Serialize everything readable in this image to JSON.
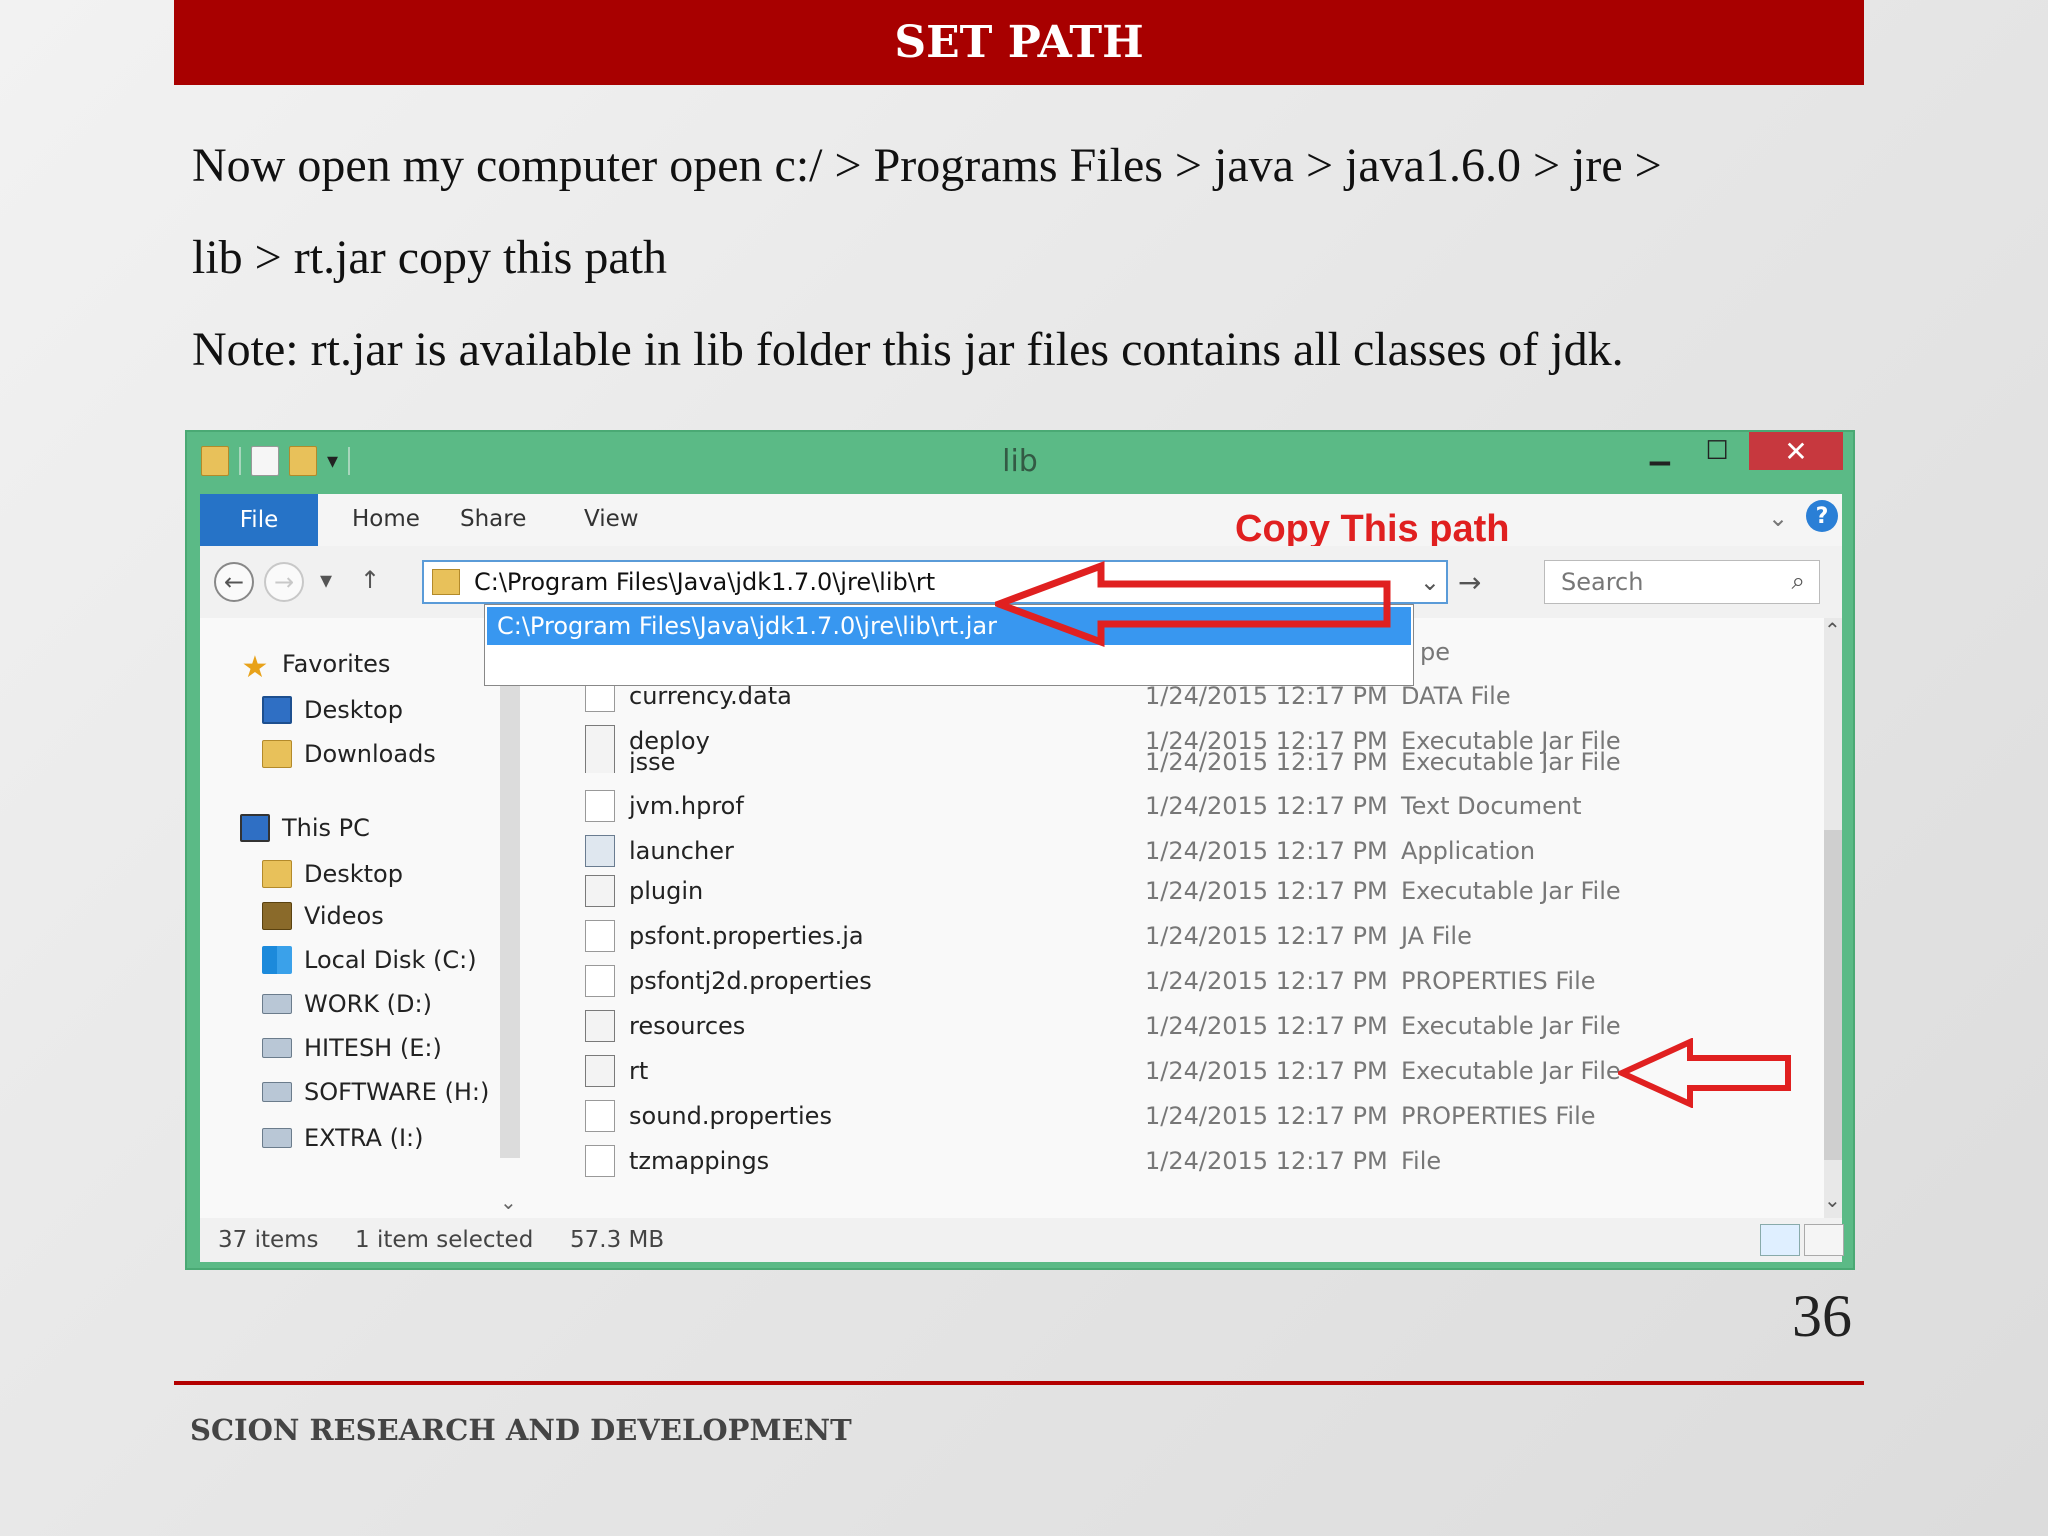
{
  "slide": {
    "title": "SET PATH",
    "line1": "Now open my computer open c:/ > Programs Files > java > java1.6.0 > jre >",
    "line2": "lib > rt.jar copy this path",
    "note": "Note: rt.jar is available in lib folder this jar files contains all classes of jdk.",
    "page_number": "36",
    "footer": "SCION RESEARCH AND DEVELOPMENT"
  },
  "window": {
    "title": "lib",
    "ribbon_tabs": [
      "File",
      "Home",
      "Share",
      "View"
    ],
    "annotation": "Copy This path",
    "address": "C:\\Program Files\\Java\\jdk1.7.0\\jre\\lib\\rt",
    "autocomplete": "C:\\Program Files\\Java\\jdk1.7.0\\jre\\lib\\rt.jar",
    "search_placeholder": "Search",
    "type_header": "pe",
    "close_glyph": "✕",
    "min_glyph": "▁",
    "max_glyph": "☐"
  },
  "nav_pane": {
    "favorites": "Favorites",
    "fav_items": [
      "Desktop",
      "Downloads"
    ],
    "this_pc": "This PC",
    "pc_items": [
      "Desktop",
      "Videos",
      "Local Disk (C:)",
      "WORK (D:)",
      "HITESH (E:)",
      "SOFTWARE (H:)",
      "EXTRA (I:)"
    ]
  },
  "files": [
    {
      "name": "currency.data",
      "date": "1/24/2015 12:17 PM",
      "type": "DATA File",
      "icon": "file"
    },
    {
      "name": "deploy",
      "date": "1/24/2015 12:17 PM",
      "type": "Executable Jar File",
      "icon": "jar"
    },
    {
      "name": "jsse",
      "date": "1/24/2015 12:17 PM",
      "type": "Executable Jar File",
      "icon": "jar"
    },
    {
      "name": "jvm.hprof",
      "date": "1/24/2015 12:17 PM",
      "type": "Text Document",
      "icon": "file"
    },
    {
      "name": "launcher",
      "date": "1/24/2015 12:17 PM",
      "type": "Application",
      "icon": "app"
    },
    {
      "name": "plugin",
      "date": "1/24/2015 12:17 PM",
      "type": "Executable Jar File",
      "icon": "jar"
    },
    {
      "name": "psfont.properties.ja",
      "date": "1/24/2015 12:17 PM",
      "type": "JA File",
      "icon": "file"
    },
    {
      "name": "psfontj2d.properties",
      "date": "1/24/2015 12:17 PM",
      "type": "PROPERTIES File",
      "icon": "file"
    },
    {
      "name": "resources",
      "date": "1/24/2015 12:17 PM",
      "type": "Executable Jar File",
      "icon": "jar"
    },
    {
      "name": "rt",
      "date": "1/24/2015 12:17 PM",
      "type": "Executable Jar File",
      "icon": "jar"
    },
    {
      "name": "sound.properties",
      "date": "1/24/2015 12:17 PM",
      "type": "PROPERTIES File",
      "icon": "file"
    },
    {
      "name": "tzmappings",
      "date": "1/24/2015 12:17 PM",
      "type": "File",
      "icon": "file"
    }
  ],
  "status": {
    "items": "37 items",
    "selected": "1 item selected",
    "size": "57.3 MB"
  },
  "colors": {
    "title_bar": "#a80000",
    "window_frame": "#5bba86",
    "file_tab": "#2673c7",
    "selection": "#3897f0",
    "annotation": "#e02020"
  }
}
